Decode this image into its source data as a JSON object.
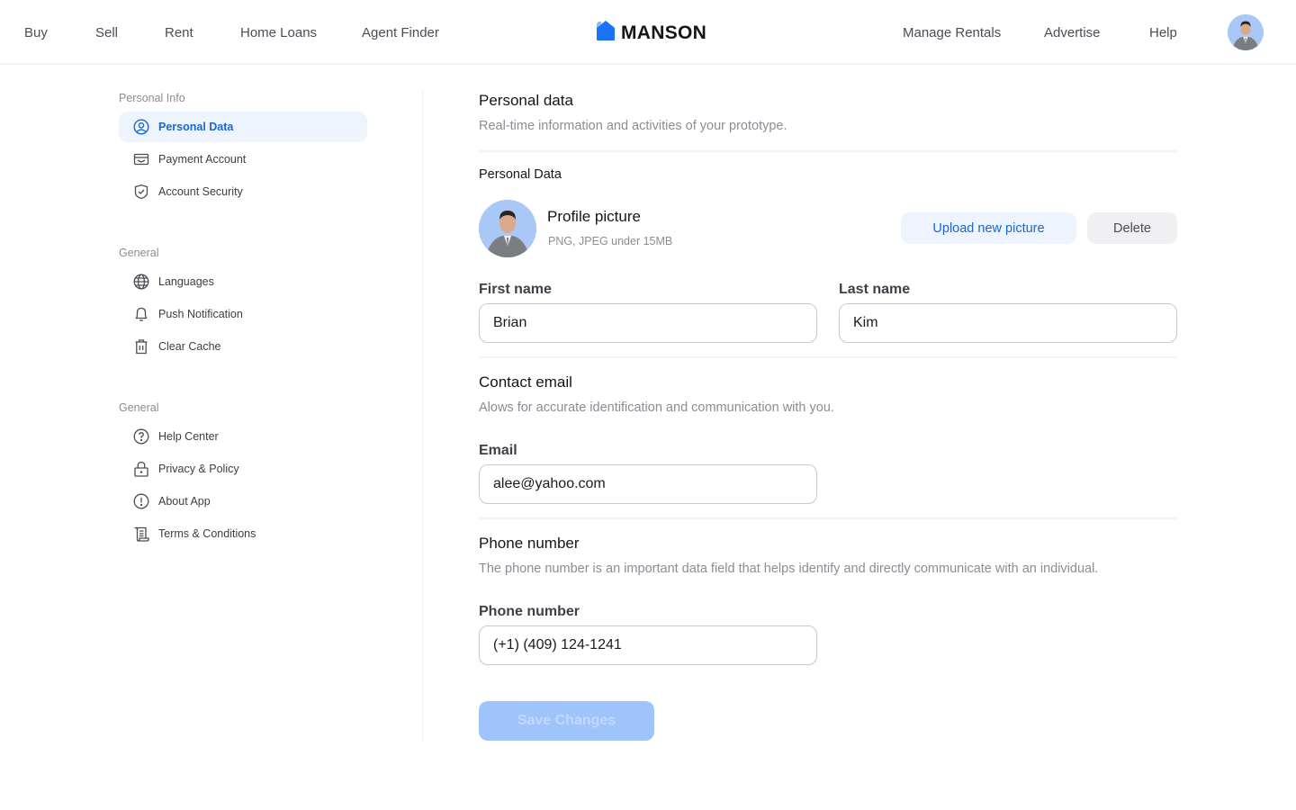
{
  "topnav": {
    "left_links": [
      "Buy",
      "Sell",
      "Rent",
      "Home Loans",
      "Agent Finder"
    ],
    "brand": "MANSON",
    "right_links": [
      "Manage Rentals",
      "Advertise",
      "Help"
    ],
    "brand_color": "#1a73f5"
  },
  "sidebar": {
    "groups": [
      {
        "label": "Personal Info",
        "items": [
          {
            "label": "Personal Data",
            "icon": "user-circle-icon",
            "active": true
          },
          {
            "label": "Payment Account",
            "icon": "wallet-icon",
            "active": false
          },
          {
            "label": "Account Security",
            "icon": "shield-check-icon",
            "active": false
          }
        ]
      },
      {
        "label": "General",
        "items": [
          {
            "label": "Languages",
            "icon": "globe-icon",
            "active": false
          },
          {
            "label": "Push Notification",
            "icon": "bell-icon",
            "active": false
          },
          {
            "label": "Clear Cache",
            "icon": "trash-icon",
            "active": false
          }
        ]
      },
      {
        "label": "General",
        "items": [
          {
            "label": "Help Center",
            "icon": "help-circle-icon",
            "active": false
          },
          {
            "label": "Privacy & Policy",
            "icon": "lock-icon",
            "active": false
          },
          {
            "label": "About App",
            "icon": "info-circle-icon",
            "active": false
          },
          {
            "label": "Terms & Conditions",
            "icon": "scroll-icon",
            "active": false
          }
        ]
      }
    ]
  },
  "main": {
    "title": "Personal data",
    "subtitle": "Real-time information and activities of your prototype.",
    "section_label": "Personal Data",
    "profile_picture": {
      "title": "Profile picture",
      "hint": "PNG,  JPEG under 15MB",
      "upload_label": "Upload new picture",
      "delete_label": "Delete"
    },
    "first_name": {
      "label": "First name",
      "value": "Brian"
    },
    "last_name": {
      "label": "Last name",
      "value": "Kim"
    },
    "contact": {
      "title": "Contact email",
      "subtitle": "Alows for accurate identification and communication with you.",
      "email_label": "Email",
      "email_value": "alee@yahoo.com"
    },
    "phone": {
      "title": "Phone number",
      "subtitle": "The phone number is an important data field that helps identify and directly communicate with an individual.",
      "label": "Phone number",
      "value": "(+1) (409) 124-1241"
    },
    "save_label": "Save Changes",
    "save_enabled": false
  }
}
